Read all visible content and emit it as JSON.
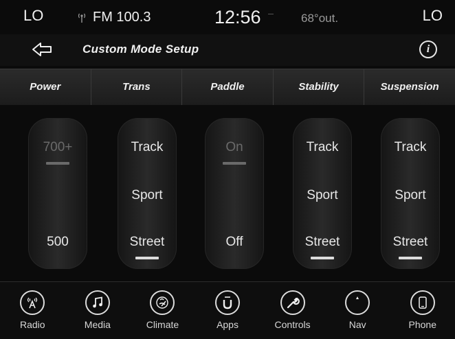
{
  "status": {
    "left_temp": "LO",
    "radio": "FM 100.3",
    "time": "12:56",
    "outside_temp": "68°out.",
    "right_temp": "LO"
  },
  "titlebar": {
    "title": "Custom Mode Setup"
  },
  "columns": [
    {
      "header": "Power"
    },
    {
      "header": "Trans"
    },
    {
      "header": "Paddle"
    },
    {
      "header": "Stability"
    },
    {
      "header": "Suspension"
    }
  ],
  "selectors": {
    "power": {
      "top": "700+",
      "bottom": "500",
      "selected": "500"
    },
    "trans": {
      "top": "Track",
      "middle": "Sport",
      "bottom": "Street",
      "selected": "Street"
    },
    "paddle": {
      "top": "On",
      "bottom": "Off",
      "selected": "Off"
    },
    "stability": {
      "top": "Track",
      "middle": "Sport",
      "bottom": "Street",
      "selected": "Street"
    },
    "suspension": {
      "top": "Track",
      "middle": "Sport",
      "bottom": "Street",
      "selected": "Street"
    }
  },
  "nav": [
    {
      "label": "Radio",
      "icon": "radio-icon"
    },
    {
      "label": "Media",
      "icon": "music-note-icon"
    },
    {
      "label": "Climate",
      "icon": "climate-icon"
    },
    {
      "label": "Apps",
      "icon": "apps-icon"
    },
    {
      "label": "Controls",
      "icon": "wrench-icon"
    },
    {
      "label": "Nav",
      "icon": "compass-icon"
    },
    {
      "label": "Phone",
      "icon": "phone-icon"
    }
  ]
}
